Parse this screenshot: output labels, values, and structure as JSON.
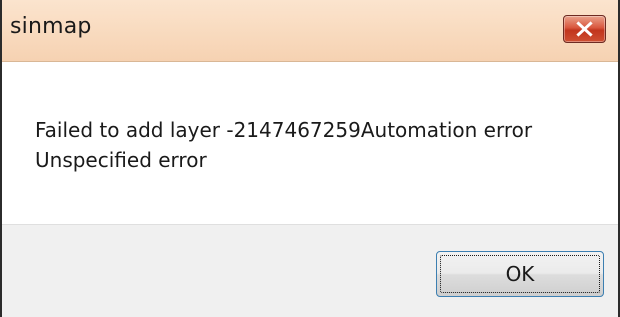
{
  "window": {
    "title": "sinmap",
    "close_icon": "close-icon"
  },
  "message": {
    "line1": "Failed to add layer -2147467259Automation error",
    "line2": "Unspecified error"
  },
  "buttons": {
    "ok_label": "OK"
  },
  "colors": {
    "titlebar": "#f9dcc1",
    "close_button": "#c1351d",
    "footer": "#f0f0f0",
    "ok_focus_border": "#3c7fb1"
  }
}
